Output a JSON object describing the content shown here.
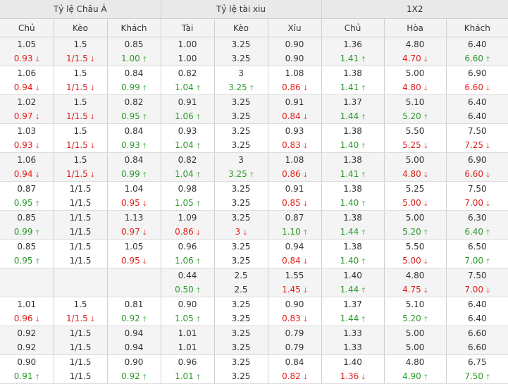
{
  "headers": {
    "groups": [
      "Tỷ lệ Châu Á",
      "Tỷ lệ tài xiu",
      "1X2"
    ],
    "columns": [
      "Chủ",
      "Kèo",
      "Khách",
      "Tài",
      "Kèo",
      "Xỉu",
      "Chủ",
      "Hòa",
      "Khách"
    ]
  },
  "colors": {
    "up": "#2a9a2a",
    "down": "#e0201a",
    "neutral": "#333333"
  },
  "arrows": {
    "up": "🡑",
    "down": "🡓"
  },
  "rows": [
    [
      {
        "a": {
          "v": "1.05"
        },
        "b": {
          "v": "0.93",
          "d": "down"
        }
      },
      {
        "a": {
          "v": "1.5"
        },
        "b": {
          "v": "1/1.5",
          "d": "down"
        }
      },
      {
        "a": {
          "v": "0.85"
        },
        "b": {
          "v": "1.00",
          "d": "up"
        }
      },
      {
        "a": {
          "v": "1.00"
        },
        "b": {
          "v": "1.00"
        }
      },
      {
        "a": {
          "v": "3.25"
        },
        "b": {
          "v": "3.25"
        }
      },
      {
        "a": {
          "v": "0.90"
        },
        "b": {
          "v": "0.90"
        }
      },
      {
        "a": {
          "v": "1.36"
        },
        "b": {
          "v": "1.41",
          "d": "up"
        }
      },
      {
        "a": {
          "v": "4.80"
        },
        "b": {
          "v": "4.70",
          "d": "down"
        }
      },
      {
        "a": {
          "v": "6.40"
        },
        "b": {
          "v": "6.60",
          "d": "up"
        }
      }
    ],
    [
      {
        "a": {
          "v": "1.06"
        },
        "b": {
          "v": "0.94",
          "d": "down"
        }
      },
      {
        "a": {
          "v": "1.5"
        },
        "b": {
          "v": "1/1.5",
          "d": "down"
        }
      },
      {
        "a": {
          "v": "0.84"
        },
        "b": {
          "v": "0.99",
          "d": "up"
        }
      },
      {
        "a": {
          "v": "0.82"
        },
        "b": {
          "v": "1.04",
          "d": "up"
        }
      },
      {
        "a": {
          "v": "3"
        },
        "b": {
          "v": "3.25",
          "d": "up"
        }
      },
      {
        "a": {
          "v": "1.08"
        },
        "b": {
          "v": "0.86",
          "d": "down"
        }
      },
      {
        "a": {
          "v": "1.38"
        },
        "b": {
          "v": "1.41",
          "d": "up"
        }
      },
      {
        "a": {
          "v": "5.00"
        },
        "b": {
          "v": "4.80",
          "d": "down"
        }
      },
      {
        "a": {
          "v": "6.90"
        },
        "b": {
          "v": "6.60",
          "d": "down"
        }
      }
    ],
    [
      {
        "a": {
          "v": "1.02"
        },
        "b": {
          "v": "0.97",
          "d": "down"
        }
      },
      {
        "a": {
          "v": "1.5"
        },
        "b": {
          "v": "1/1.5",
          "d": "down"
        }
      },
      {
        "a": {
          "v": "0.82"
        },
        "b": {
          "v": "0.95",
          "d": "up"
        }
      },
      {
        "a": {
          "v": "0.91"
        },
        "b": {
          "v": "1.06",
          "d": "up"
        }
      },
      {
        "a": {
          "v": "3.25"
        },
        "b": {
          "v": "3.25"
        }
      },
      {
        "a": {
          "v": "0.91"
        },
        "b": {
          "v": "0.84",
          "d": "down"
        }
      },
      {
        "a": {
          "v": "1.37"
        },
        "b": {
          "v": "1.44",
          "d": "up"
        }
      },
      {
        "a": {
          "v": "5.10"
        },
        "b": {
          "v": "5.20",
          "d": "up"
        }
      },
      {
        "a": {
          "v": "6.40"
        },
        "b": {
          "v": "6.40"
        }
      }
    ],
    [
      {
        "a": {
          "v": "1.03"
        },
        "b": {
          "v": "0.93",
          "d": "down"
        }
      },
      {
        "a": {
          "v": "1.5"
        },
        "b": {
          "v": "1/1.5",
          "d": "down"
        }
      },
      {
        "a": {
          "v": "0.84"
        },
        "b": {
          "v": "0.93",
          "d": "up"
        }
      },
      {
        "a": {
          "v": "0.93"
        },
        "b": {
          "v": "1.04",
          "d": "up"
        }
      },
      {
        "a": {
          "v": "3.25"
        },
        "b": {
          "v": "3.25"
        }
      },
      {
        "a": {
          "v": "0.93"
        },
        "b": {
          "v": "0.83",
          "d": "down"
        }
      },
      {
        "a": {
          "v": "1.38"
        },
        "b": {
          "v": "1.40",
          "d": "up"
        }
      },
      {
        "a": {
          "v": "5.50"
        },
        "b": {
          "v": "5.25",
          "d": "down"
        }
      },
      {
        "a": {
          "v": "7.50"
        },
        "b": {
          "v": "7.25",
          "d": "down"
        }
      }
    ],
    [
      {
        "a": {
          "v": "1.06"
        },
        "b": {
          "v": "0.94",
          "d": "down"
        }
      },
      {
        "a": {
          "v": "1.5"
        },
        "b": {
          "v": "1/1.5",
          "d": "down"
        }
      },
      {
        "a": {
          "v": "0.84"
        },
        "b": {
          "v": "0.99",
          "d": "up"
        }
      },
      {
        "a": {
          "v": "0.82"
        },
        "b": {
          "v": "1.04",
          "d": "up"
        }
      },
      {
        "a": {
          "v": "3"
        },
        "b": {
          "v": "3.25",
          "d": "up"
        }
      },
      {
        "a": {
          "v": "1.08"
        },
        "b": {
          "v": "0.86",
          "d": "down"
        }
      },
      {
        "a": {
          "v": "1.38"
        },
        "b": {
          "v": "1.41",
          "d": "up"
        }
      },
      {
        "a": {
          "v": "5.00"
        },
        "b": {
          "v": "4.80",
          "d": "down"
        }
      },
      {
        "a": {
          "v": "6.90"
        },
        "b": {
          "v": "6.60",
          "d": "down"
        }
      }
    ],
    [
      {
        "a": {
          "v": "0.87"
        },
        "b": {
          "v": "0.95",
          "d": "up"
        }
      },
      {
        "a": {
          "v": "1/1.5"
        },
        "b": {
          "v": "1/1.5"
        }
      },
      {
        "a": {
          "v": "1.04"
        },
        "b": {
          "v": "0.95",
          "d": "down"
        }
      },
      {
        "a": {
          "v": "0.98"
        },
        "b": {
          "v": "1.05",
          "d": "up"
        }
      },
      {
        "a": {
          "v": "3.25"
        },
        "b": {
          "v": "3.25"
        }
      },
      {
        "a": {
          "v": "0.91"
        },
        "b": {
          "v": "0.85",
          "d": "down"
        }
      },
      {
        "a": {
          "v": "1.38"
        },
        "b": {
          "v": "1.40",
          "d": "up"
        }
      },
      {
        "a": {
          "v": "5.25"
        },
        "b": {
          "v": "5.00",
          "d": "down"
        }
      },
      {
        "a": {
          "v": "7.50"
        },
        "b": {
          "v": "7.00",
          "d": "down"
        }
      }
    ],
    [
      {
        "a": {
          "v": "0.85"
        },
        "b": {
          "v": "0.99",
          "d": "up"
        }
      },
      {
        "a": {
          "v": "1/1.5"
        },
        "b": {
          "v": "1/1.5"
        }
      },
      {
        "a": {
          "v": "1.13"
        },
        "b": {
          "v": "0.97",
          "d": "down"
        }
      },
      {
        "a": {
          "v": "1.09"
        },
        "b": {
          "v": "0.86",
          "d": "down"
        }
      },
      {
        "a": {
          "v": "3.25"
        },
        "b": {
          "v": "3",
          "d": "down"
        }
      },
      {
        "a": {
          "v": "0.87"
        },
        "b": {
          "v": "1.10",
          "d": "up"
        }
      },
      {
        "a": {
          "v": "1.38"
        },
        "b": {
          "v": "1.44",
          "d": "up"
        }
      },
      {
        "a": {
          "v": "5.00"
        },
        "b": {
          "v": "5.20",
          "d": "up"
        }
      },
      {
        "a": {
          "v": "6.30"
        },
        "b": {
          "v": "6.40",
          "d": "up"
        }
      }
    ],
    [
      {
        "a": {
          "v": "0.85"
        },
        "b": {
          "v": "0.95",
          "d": "up"
        }
      },
      {
        "a": {
          "v": "1/1.5"
        },
        "b": {
          "v": "1/1.5"
        }
      },
      {
        "a": {
          "v": "1.05"
        },
        "b": {
          "v": "0.95",
          "d": "down"
        }
      },
      {
        "a": {
          "v": "0.96"
        },
        "b": {
          "v": "1.06",
          "d": "up"
        }
      },
      {
        "a": {
          "v": "3.25"
        },
        "b": {
          "v": "3.25"
        }
      },
      {
        "a": {
          "v": "0.94"
        },
        "b": {
          "v": "0.84",
          "d": "down"
        }
      },
      {
        "a": {
          "v": "1.38"
        },
        "b": {
          "v": "1.40",
          "d": "up"
        }
      },
      {
        "a": {
          "v": "5.50"
        },
        "b": {
          "v": "5.00",
          "d": "down"
        }
      },
      {
        "a": {
          "v": "6.50"
        },
        "b": {
          "v": "7.00",
          "d": "up"
        }
      }
    ],
    [
      {
        "a": {
          "v": ""
        },
        "b": {
          "v": ""
        }
      },
      {
        "a": {
          "v": ""
        },
        "b": {
          "v": ""
        }
      },
      {
        "a": {
          "v": ""
        },
        "b": {
          "v": ""
        }
      },
      {
        "a": {
          "v": "0.44"
        },
        "b": {
          "v": "0.50",
          "d": "up"
        }
      },
      {
        "a": {
          "v": "2.5"
        },
        "b": {
          "v": "2.5"
        }
      },
      {
        "a": {
          "v": "1.55"
        },
        "b": {
          "v": "1.45",
          "d": "down"
        }
      },
      {
        "a": {
          "v": "1.40"
        },
        "b": {
          "v": "1.44",
          "d": "up"
        }
      },
      {
        "a": {
          "v": "4.80"
        },
        "b": {
          "v": "4.75",
          "d": "down"
        }
      },
      {
        "a": {
          "v": "7.50"
        },
        "b": {
          "v": "7.00",
          "d": "down"
        }
      }
    ],
    [
      {
        "a": {
          "v": "1.01"
        },
        "b": {
          "v": "0.96",
          "d": "down"
        }
      },
      {
        "a": {
          "v": "1.5"
        },
        "b": {
          "v": "1/1.5",
          "d": "down"
        }
      },
      {
        "a": {
          "v": "0.81"
        },
        "b": {
          "v": "0.92",
          "d": "up"
        }
      },
      {
        "a": {
          "v": "0.90"
        },
        "b": {
          "v": "1.05",
          "d": "up"
        }
      },
      {
        "a": {
          "v": "3.25"
        },
        "b": {
          "v": "3.25"
        }
      },
      {
        "a": {
          "v": "0.90"
        },
        "b": {
          "v": "0.83",
          "d": "down"
        }
      },
      {
        "a": {
          "v": "1.37"
        },
        "b": {
          "v": "1.44",
          "d": "up"
        }
      },
      {
        "a": {
          "v": "5.10"
        },
        "b": {
          "v": "5.20",
          "d": "up"
        }
      },
      {
        "a": {
          "v": "6.40"
        },
        "b": {
          "v": "6.40"
        }
      }
    ],
    [
      {
        "a": {
          "v": "0.92"
        },
        "b": {
          "v": "0.92"
        }
      },
      {
        "a": {
          "v": "1/1.5"
        },
        "b": {
          "v": "1/1.5"
        }
      },
      {
        "a": {
          "v": "0.94"
        },
        "b": {
          "v": "0.94"
        }
      },
      {
        "a": {
          "v": "1.01"
        },
        "b": {
          "v": "1.01"
        }
      },
      {
        "a": {
          "v": "3.25"
        },
        "b": {
          "v": "3.25"
        }
      },
      {
        "a": {
          "v": "0.79"
        },
        "b": {
          "v": "0.79"
        }
      },
      {
        "a": {
          "v": "1.33"
        },
        "b": {
          "v": "1.33"
        }
      },
      {
        "a": {
          "v": "5.00"
        },
        "b": {
          "v": "5.00"
        }
      },
      {
        "a": {
          "v": "6.60"
        },
        "b": {
          "v": "6.60"
        }
      }
    ],
    [
      {
        "a": {
          "v": "0.90"
        },
        "b": {
          "v": "0.91",
          "d": "up"
        }
      },
      {
        "a": {
          "v": "1/1.5"
        },
        "b": {
          "v": "1/1.5"
        }
      },
      {
        "a": {
          "v": "0.90"
        },
        "b": {
          "v": "0.92",
          "d": "up"
        }
      },
      {
        "a": {
          "v": "0.96"
        },
        "b": {
          "v": "1.01",
          "d": "up"
        }
      },
      {
        "a": {
          "v": "3.25"
        },
        "b": {
          "v": "3.25"
        }
      },
      {
        "a": {
          "v": "0.84"
        },
        "b": {
          "v": "0.82",
          "d": "down"
        }
      },
      {
        "a": {
          "v": "1.40"
        },
        "b": {
          "v": "1.36",
          "d": "down"
        }
      },
      {
        "a": {
          "v": "4.80"
        },
        "b": {
          "v": "4.90",
          "d": "up"
        }
      },
      {
        "a": {
          "v": "6.75"
        },
        "b": {
          "v": "7.50",
          "d": "up"
        }
      }
    ]
  ]
}
